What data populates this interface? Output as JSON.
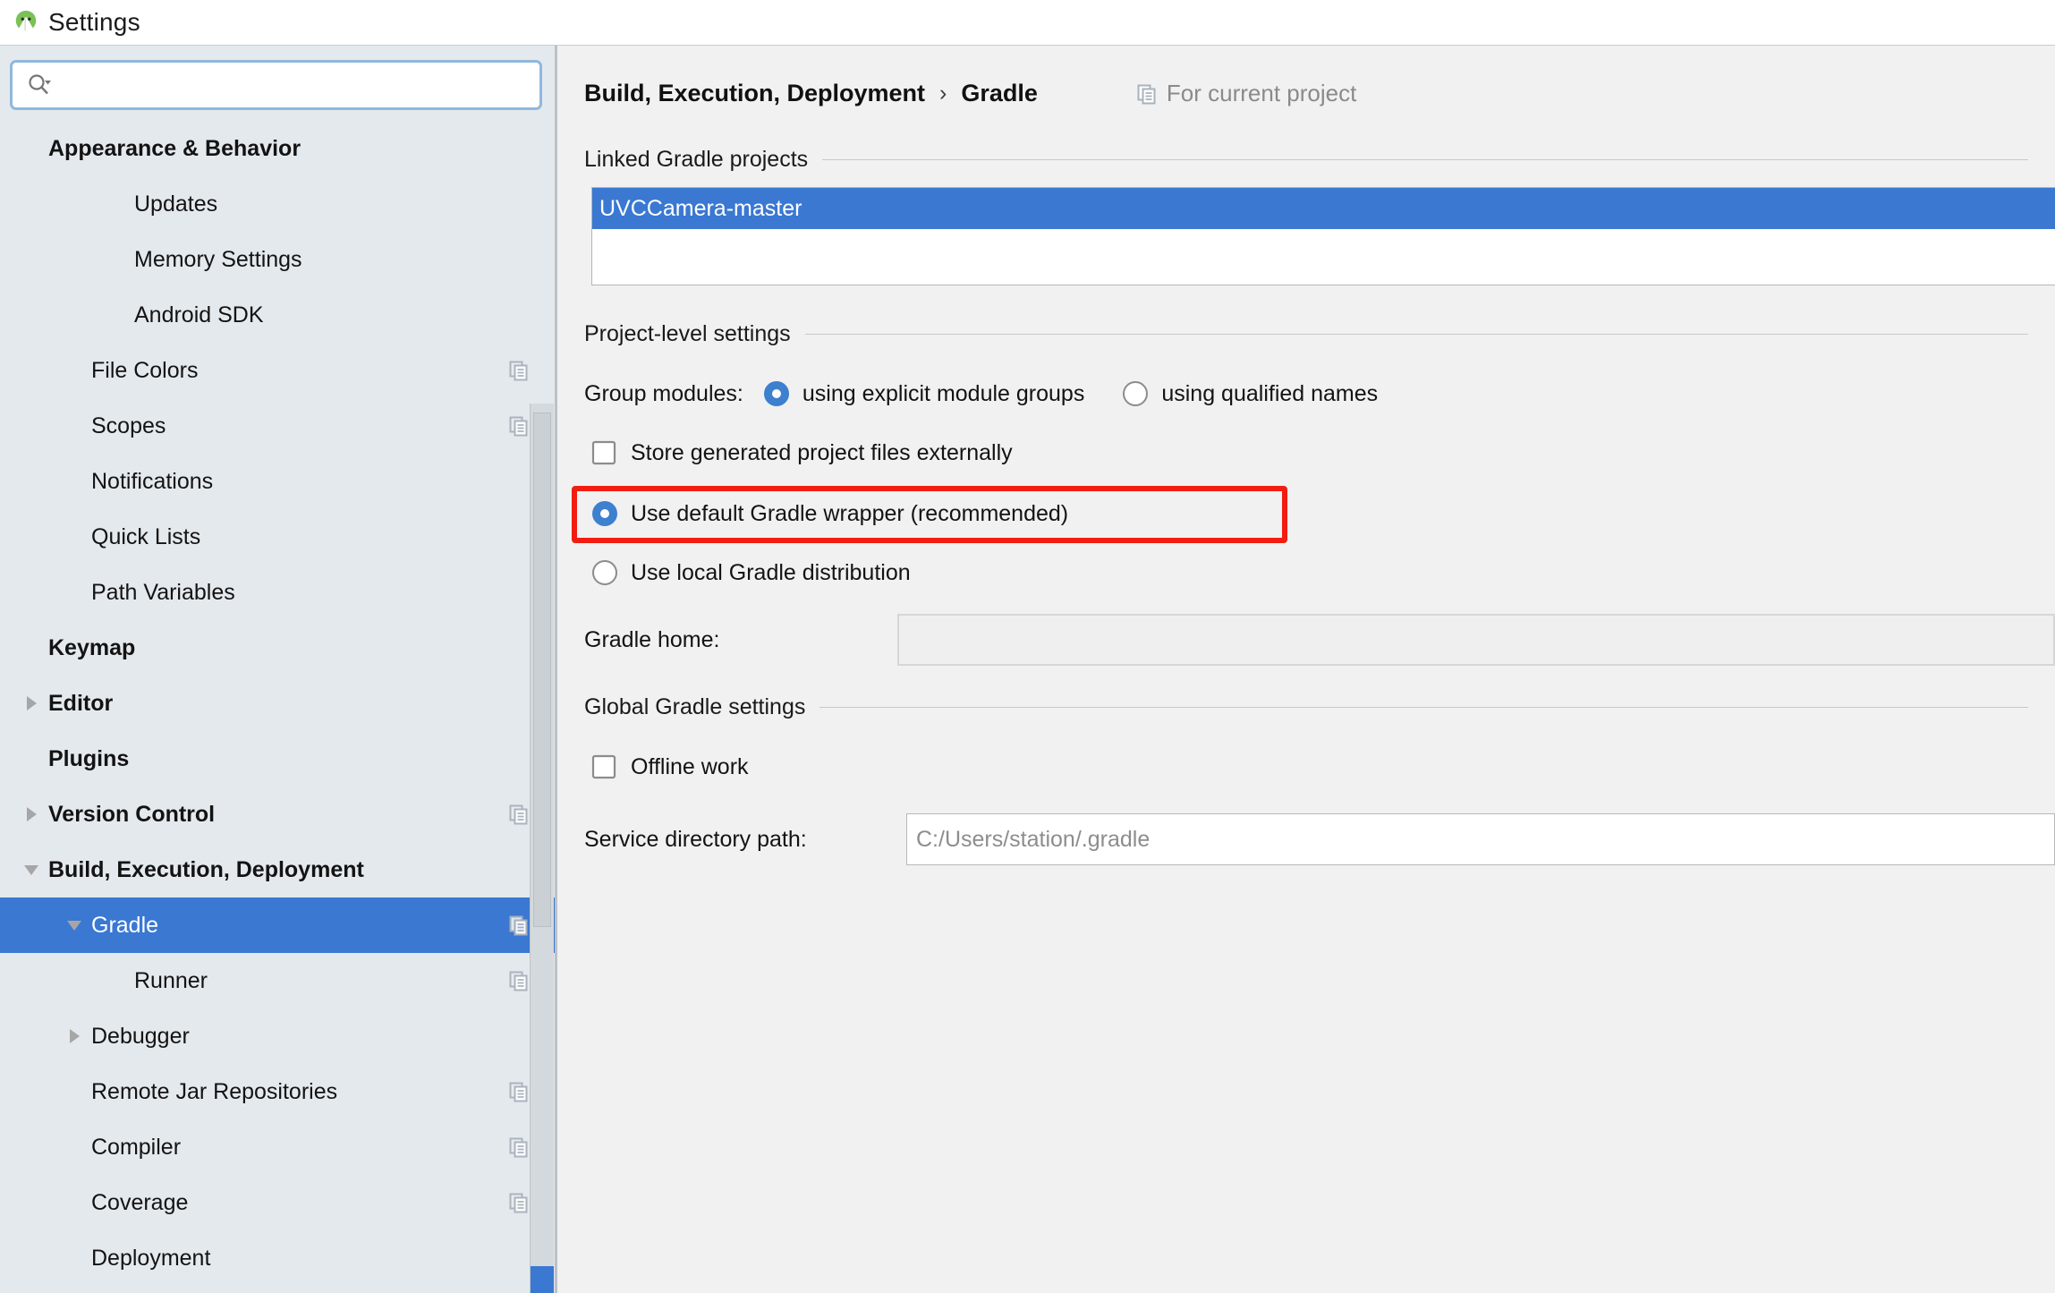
{
  "window": {
    "title": "Settings",
    "app_icon": "android-studio-icon"
  },
  "search": {
    "value": "",
    "placeholder": "",
    "icon": "search-icon"
  },
  "sidebar": {
    "items": [
      {
        "label": "Appearance & Behavior",
        "indent": 0,
        "bold": true,
        "arrow": "none",
        "copy": false,
        "selected": false
      },
      {
        "label": "Updates",
        "indent": 2,
        "bold": false,
        "arrow": "none",
        "copy": false,
        "selected": false
      },
      {
        "label": "Memory Settings",
        "indent": 2,
        "bold": false,
        "arrow": "none",
        "copy": false,
        "selected": false
      },
      {
        "label": "Android SDK",
        "indent": 2,
        "bold": false,
        "arrow": "none",
        "copy": false,
        "selected": false
      },
      {
        "label": "File Colors",
        "indent": 1,
        "bold": false,
        "arrow": "none",
        "copy": true,
        "selected": false
      },
      {
        "label": "Scopes",
        "indent": 1,
        "bold": false,
        "arrow": "none",
        "copy": true,
        "selected": false
      },
      {
        "label": "Notifications",
        "indent": 1,
        "bold": false,
        "arrow": "none",
        "copy": false,
        "selected": false
      },
      {
        "label": "Quick Lists",
        "indent": 1,
        "bold": false,
        "arrow": "none",
        "copy": false,
        "selected": false
      },
      {
        "label": "Path Variables",
        "indent": 1,
        "bold": false,
        "arrow": "none",
        "copy": false,
        "selected": false
      },
      {
        "label": "Keymap",
        "indent": 0,
        "bold": true,
        "arrow": "none",
        "copy": false,
        "selected": false
      },
      {
        "label": "Editor",
        "indent": 0,
        "bold": true,
        "arrow": "collapsed",
        "copy": false,
        "selected": false
      },
      {
        "label": "Plugins",
        "indent": 0,
        "bold": true,
        "arrow": "none",
        "copy": false,
        "selected": false
      },
      {
        "label": "Version Control",
        "indent": 0,
        "bold": true,
        "arrow": "collapsed",
        "copy": true,
        "selected": false
      },
      {
        "label": "Build, Execution, Deployment",
        "indent": 0,
        "bold": true,
        "arrow": "expanded",
        "copy": false,
        "selected": false
      },
      {
        "label": "Gradle",
        "indent": 1,
        "bold": false,
        "arrow": "expanded",
        "copy": true,
        "selected": true
      },
      {
        "label": "Runner",
        "indent": 2,
        "bold": false,
        "arrow": "none",
        "copy": true,
        "selected": false
      },
      {
        "label": "Debugger",
        "indent": 1,
        "bold": false,
        "arrow": "collapsed",
        "copy": false,
        "selected": false
      },
      {
        "label": "Remote Jar Repositories",
        "indent": 1,
        "bold": false,
        "arrow": "none",
        "copy": true,
        "selected": false
      },
      {
        "label": "Compiler",
        "indent": 1,
        "bold": false,
        "arrow": "none",
        "copy": true,
        "selected": false
      },
      {
        "label": "Coverage",
        "indent": 1,
        "bold": false,
        "arrow": "none",
        "copy": true,
        "selected": false
      },
      {
        "label": "Deployment",
        "indent": 1,
        "bold": false,
        "arrow": "none",
        "copy": false,
        "selected": false
      }
    ],
    "scrollbar": {
      "name": "sidebar-scrollbar"
    }
  },
  "content": {
    "breadcrumb": {
      "parent": "Build, Execution, Deployment",
      "separator": "›",
      "current": "Gradle",
      "scope_icon": "copy-icon",
      "scope_label": "For current project"
    },
    "linked_projects": {
      "section_title": "Linked Gradle projects",
      "items": [
        "UVCCamera-master"
      ],
      "selected_index": 0
    },
    "project_level": {
      "section_title": "Project-level settings",
      "group_modules_label": "Group modules:",
      "group_modules_options": [
        {
          "label": "using explicit module groups",
          "selected": true
        },
        {
          "label": "using qualified names",
          "selected": false
        }
      ],
      "store_generated_label": "Store generated project files externally",
      "store_generated_checked": false,
      "distribution_options": [
        {
          "label": "Use default Gradle wrapper (recommended)",
          "selected": true,
          "highlighted": true
        },
        {
          "label": "Use local Gradle distribution",
          "selected": false,
          "highlighted": false
        }
      ],
      "gradle_home_label": "Gradle home:",
      "gradle_home_value": "",
      "gradle_home_enabled": false
    },
    "global_settings": {
      "section_title": "Global Gradle settings",
      "offline_label": "Offline work",
      "offline_checked": false,
      "service_dir_label": "Service directory path:",
      "service_dir_value": "C:/Users/station/.gradle"
    }
  },
  "colors": {
    "selection_blue": "#3a78d2",
    "highlight_red": "#f21d11",
    "sidebar_bg": "#e4e9ee",
    "content_bg": "#f1f1f1",
    "radio_blue": "#3c80cf"
  }
}
